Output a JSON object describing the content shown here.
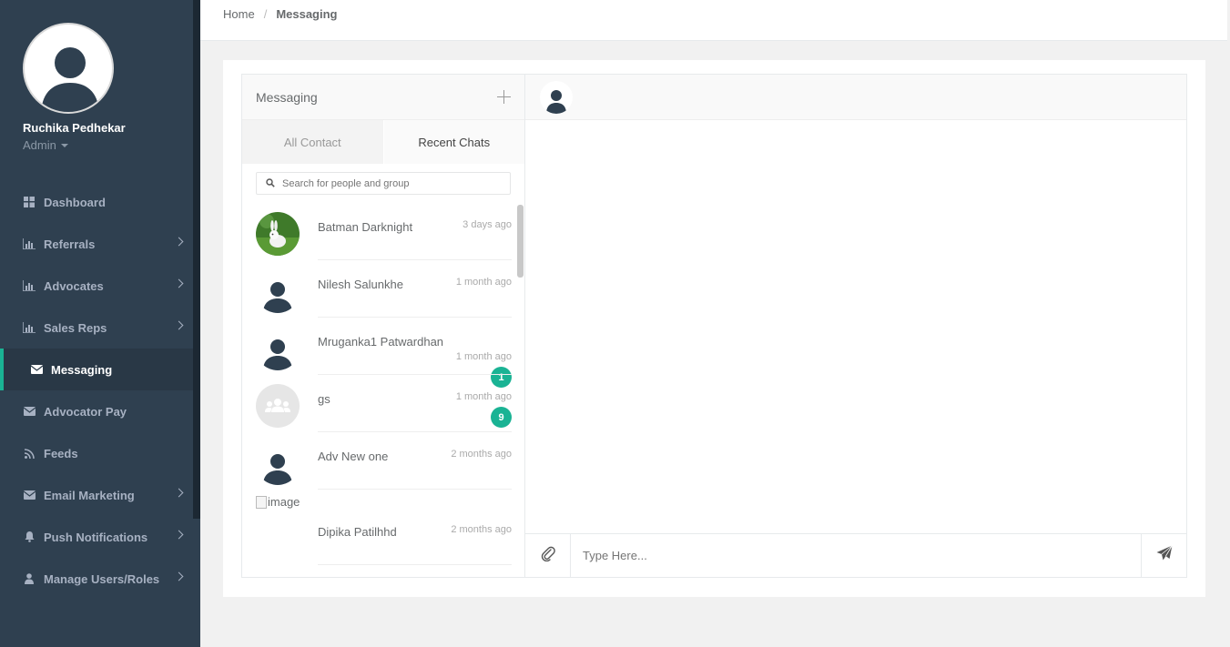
{
  "user": {
    "name": "Ruchika Pedhekar",
    "role": "Admin"
  },
  "nav": [
    {
      "label": "Dashboard",
      "icon": "dashboard-icon",
      "chevron": false,
      "active": false
    },
    {
      "label": "Referrals",
      "icon": "bar-chart-icon",
      "chevron": true,
      "active": false
    },
    {
      "label": "Advocates",
      "icon": "bar-chart-icon",
      "chevron": true,
      "active": false
    },
    {
      "label": "Sales Reps",
      "icon": "bar-chart-icon",
      "chevron": true,
      "active": false
    },
    {
      "label": "Messaging",
      "icon": "envelope-icon",
      "chevron": false,
      "active": true
    },
    {
      "label": "Advocator Pay",
      "icon": "envelope-icon",
      "chevron": false,
      "active": false
    },
    {
      "label": "Feeds",
      "icon": "rss-icon",
      "chevron": false,
      "active": false
    },
    {
      "label": "Email Marketing",
      "icon": "envelope-icon",
      "chevron": true,
      "active": false
    },
    {
      "label": "Push Notifications",
      "icon": "bell-icon",
      "chevron": true,
      "active": false
    },
    {
      "label": "Manage Users/Roles",
      "icon": "user-icon",
      "chevron": true,
      "active": false
    }
  ],
  "breadcrumb": {
    "home": "Home",
    "sep": "/",
    "current": "Messaging"
  },
  "messaging": {
    "title": "Messaging",
    "tabs": {
      "all": "All Contact",
      "recent": "Recent Chats"
    },
    "search_placeholder": "Search for people and group",
    "contacts": [
      {
        "name": "Batman Darknight",
        "time": "3 days ago",
        "badge": "",
        "avatar": "bunny-photo"
      },
      {
        "name": "Nilesh Salunkhe",
        "time": "1 month ago",
        "badge": "",
        "avatar": "person-silhouette"
      },
      {
        "name": "Mruganka1 Patwardhan",
        "time": "1 month ago",
        "badge": "1",
        "avatar": "person-silhouette"
      },
      {
        "name": "gs",
        "time": "1 month ago",
        "badge": "9",
        "avatar": "group-icon"
      },
      {
        "name": "Adv New one",
        "time": "2 months ago",
        "badge": "",
        "avatar": "person-silhouette"
      },
      {
        "name": "Dipika Patilhhd",
        "time": "2 months ago",
        "badge": "",
        "avatar": "broken-image",
        "alt": "image"
      }
    ]
  },
  "composer": {
    "placeholder": "Type Here..."
  },
  "colors": {
    "sidebar": "#2f4050",
    "accent": "#1ab394",
    "nav_text": "#a7b1c2"
  }
}
